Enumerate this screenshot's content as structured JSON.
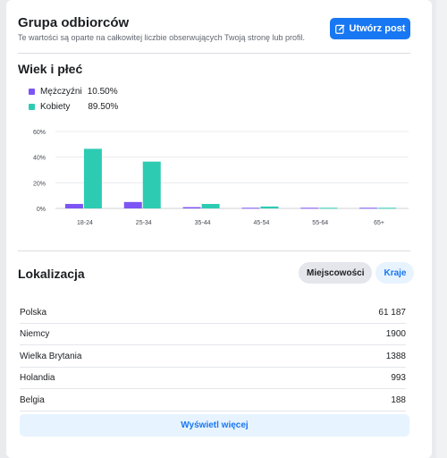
{
  "header": {
    "title": "Grupa odbiorców",
    "subtitle": "Te wartości są oparte na całkowitej liczbie obserwujących Twoją stronę lub profil.",
    "create_post_label": "Utwórz post"
  },
  "age_gender": {
    "title": "Wiek i płeć",
    "legend": [
      {
        "label": "Mężczyźni",
        "value": "10.50%",
        "color": "#7d55f5"
      },
      {
        "label": "Kobiety",
        "value": "89.50%",
        "color": "#2ecbb3"
      }
    ]
  },
  "chart_data": {
    "type": "bar",
    "categories": [
      "18-24",
      "25-34",
      "35-44",
      "45-54",
      "55-64",
      "65+"
    ],
    "series": [
      {
        "name": "Mężczyźni",
        "values": [
          3.5,
          5.0,
          1.0,
          0.5,
          0.5,
          0.5
        ],
        "color": "#7d55f5"
      },
      {
        "name": "Kobiety",
        "values": [
          46.5,
          36.5,
          3.5,
          1.5,
          0.5,
          0.5
        ],
        "color": "#2ecbb3"
      }
    ],
    "y_ticks": [
      "0%",
      "20%",
      "40%",
      "60%"
    ],
    "ylim": [
      0,
      60
    ],
    "grid": true
  },
  "location": {
    "title": "Lokalizacja",
    "tabs": [
      {
        "label": "Miejscowości",
        "active": true
      },
      {
        "label": "Kraje",
        "active": false
      }
    ],
    "rows": [
      {
        "name": "Polska",
        "value": "61 187"
      },
      {
        "name": "Niemcy",
        "value": "1900"
      },
      {
        "name": "Wielka Brytania",
        "value": "1388"
      },
      {
        "name": "Holandia",
        "value": "993"
      },
      {
        "name": "Belgia",
        "value": "188"
      }
    ],
    "show_more_label": "Wyświetl więcej"
  },
  "colors": {
    "accent": "#1877f2",
    "men": "#7d55f5",
    "women": "#2ecbb3"
  }
}
